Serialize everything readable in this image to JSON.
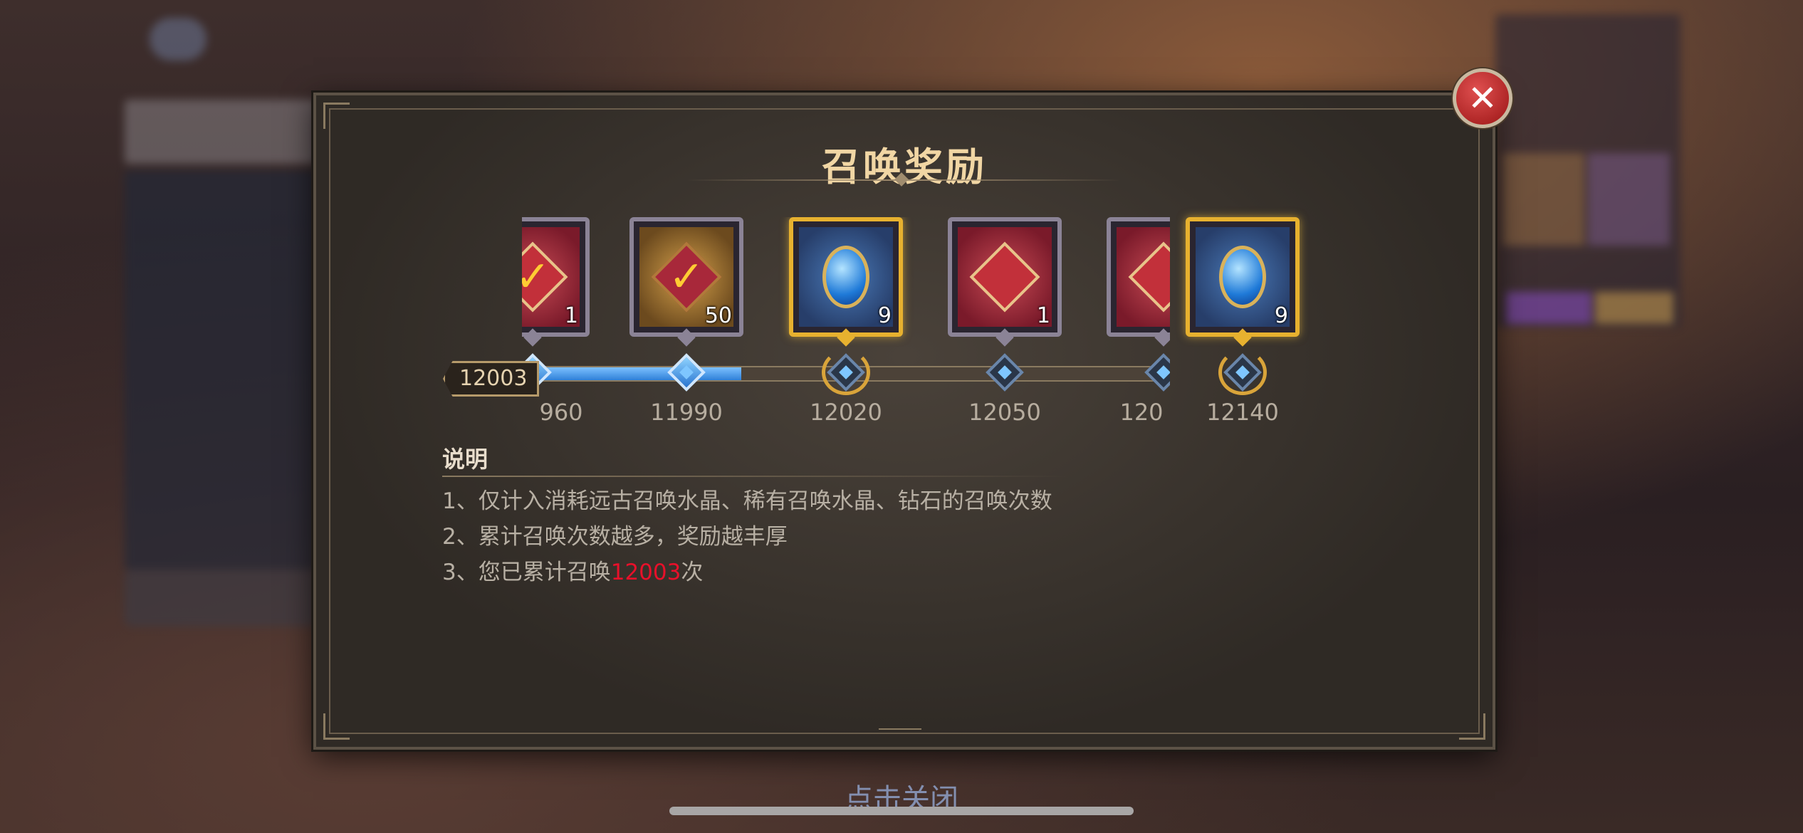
{
  "modal": {
    "title": "召唤奖励",
    "close_icon_glyph": "✕"
  },
  "track": {
    "current_count": "12003",
    "progress_fraction": 0.7,
    "rewards": [
      {
        "milestone": "960",
        "qty": "1",
        "item": "red-summon-cube",
        "claimed": true,
        "frame": "silver"
      },
      {
        "milestone": "11990",
        "qty": "50",
        "item": "crystal-ore",
        "claimed": true,
        "frame": "silver"
      },
      {
        "milestone": "12020",
        "qty": "9",
        "item": "blue-gem-amulet",
        "claimed": false,
        "frame": "gold"
      },
      {
        "milestone": "12050",
        "qty": "1",
        "item": "red-summon-cube",
        "claimed": false,
        "frame": "silver"
      },
      {
        "milestone": "120",
        "qty": "",
        "item": "red-summon-cube",
        "claimed": false,
        "frame": "silver"
      }
    ],
    "final_reward": {
      "milestone": "12140",
      "qty": "9",
      "item": "blue-gem-amulet",
      "frame": "gold"
    }
  },
  "description": {
    "title": "说明",
    "line1": "1、仅计入消耗远古召唤水晶、稀有召唤水晶、钻石的召唤次数",
    "line2": "2、累计召唤次数越多，奖励越丰厚",
    "line3_prefix": "3、您已累计召唤",
    "line3_count": "12003",
    "line3_suffix": "次"
  },
  "footer": {
    "tap_to_close": "点击关闭"
  },
  "colors": {
    "highlight": "#e8102a",
    "gold_frame": "#e7b12f",
    "progress_blue": "#2f80d8",
    "title": "#f1d6a4"
  }
}
